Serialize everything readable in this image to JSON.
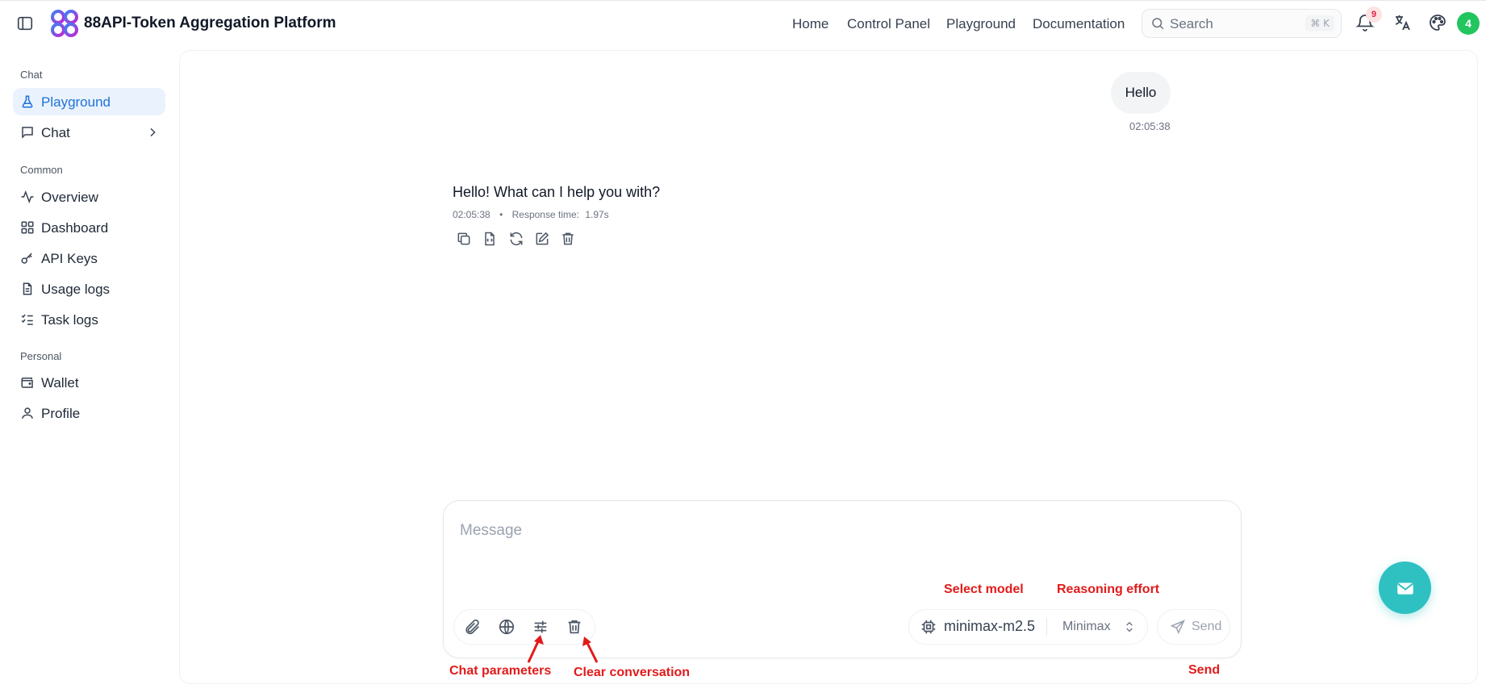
{
  "header": {
    "title": "88API-Token Aggregation Platform",
    "nav": [
      {
        "label": "Home"
      },
      {
        "label": "Control Panel"
      },
      {
        "label": "Playground"
      },
      {
        "label": "Documentation"
      }
    ],
    "search": {
      "placeholder": "Search",
      "shortcut": "⌘ K"
    },
    "notifications_count": "9",
    "avatar_text": "4"
  },
  "sidebar": {
    "sections": [
      {
        "label": "Chat"
      },
      {
        "label": "Common"
      },
      {
        "label": "Personal"
      }
    ],
    "items": [
      {
        "label": "Playground",
        "icon": "flask-icon",
        "active": true
      },
      {
        "label": "Chat",
        "icon": "message-square-icon"
      },
      {
        "label": "Overview",
        "icon": "activity-icon"
      },
      {
        "label": "Dashboard",
        "icon": "grid-icon"
      },
      {
        "label": "API Keys",
        "icon": "key-icon"
      },
      {
        "label": "Usage logs",
        "icon": "file-text-icon"
      },
      {
        "label": "Task logs",
        "icon": "list-checks-icon"
      },
      {
        "label": "Wallet",
        "icon": "wallet-icon"
      },
      {
        "label": "Profile",
        "icon": "user-icon"
      }
    ]
  },
  "conversation": {
    "user_message": {
      "text": "Hello",
      "time": "02:05:38"
    },
    "assistant_message": {
      "text": "Hello! What can I help you with?",
      "time": "02:05:38",
      "separator": "•",
      "response_time_label": "Response time:",
      "response_time_value": "1.97s"
    }
  },
  "composer": {
    "placeholder": "Message",
    "model": "minimax-m2.5",
    "reasoning_effort": "Minimax",
    "send_label": "Send"
  },
  "annotations": {
    "select_model": "Select model",
    "reasoning_effort": "Reasoning effort",
    "chat_parameters": "Chat parameters",
    "clear_conversation": "Clear conversation",
    "send": "Send"
  },
  "colors": {
    "accent": "#1d72d8",
    "annotation": "#e11b1b",
    "fab": "#2fc1c1"
  }
}
